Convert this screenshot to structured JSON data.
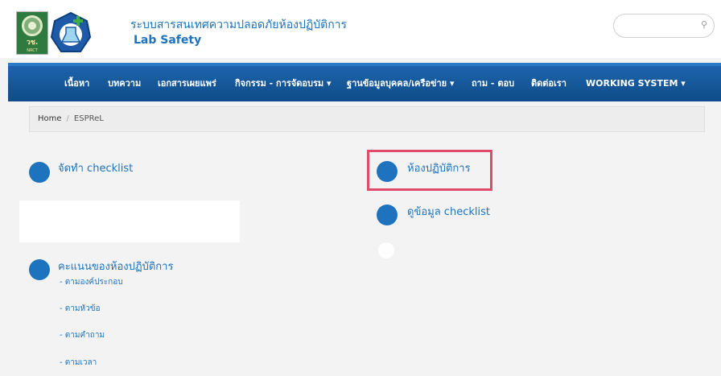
{
  "header": {
    "title": "ระบบสารสนเทศความปลอดภัยห้องปฏิบัติการ",
    "subtitle": "Lab Safety",
    "logo_left_text": "วช.",
    "logo_left_subtext": "NRCT",
    "logo_right_text": "Lab Safety"
  },
  "search": {
    "placeholder": "",
    "icon": "search-icon"
  },
  "nav": {
    "items": [
      {
        "label": "เนื้อหา"
      },
      {
        "label": "บทความ"
      },
      {
        "label": "เอกสารเผยแพร่"
      },
      {
        "label": "กิจกรรม - การจัดอบรม ▾"
      },
      {
        "label": "ฐานข้อมูลบุคคล/เครือข่าย ▾"
      },
      {
        "label": "ถาม - ตอบ"
      },
      {
        "label": "ติดต่อเรา"
      },
      {
        "label": "WORKING SYSTEM ▾"
      }
    ]
  },
  "breadcrumb": {
    "home": "Home",
    "separator": "/",
    "current": "ESPReL"
  },
  "menu": {
    "checklist": "จัดทำ checklist",
    "lab": "ห้องปฏิบัติการ",
    "view_checklist": "ดูข้อมูล checklist",
    "score": "คะแนนของห้องปฏิบัติการ",
    "score_links": [
      "- ตามองค์ประกอบ",
      "- ตามหัวข้อ",
      "- ตามคำถาม",
      "- ตามเวลา"
    ]
  },
  "colors": {
    "accent": "#1e73be",
    "nav_bg": "#0f4c88",
    "highlight": "#e24a6c"
  }
}
